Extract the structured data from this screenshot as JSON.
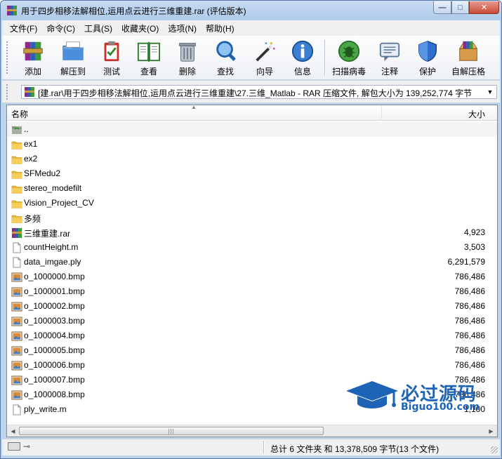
{
  "window": {
    "title": "用于四步相移法解相位,运用点云进行三维重建.rar (评估版本)",
    "controls": {
      "minimize": "—",
      "maximize": "□",
      "close": "✕"
    }
  },
  "menu": [
    "文件(F)",
    "命令(C)",
    "工具(S)",
    "收藏夹(O)",
    "选项(N)",
    "帮助(H)"
  ],
  "toolbar": {
    "buttons": [
      {
        "label": "添加",
        "icon": "add-archive-icon"
      },
      {
        "label": "解压到",
        "icon": "extract-folder-icon"
      },
      {
        "label": "测试",
        "icon": "test-clipboard-icon"
      },
      {
        "label": "查看",
        "icon": "view-book-icon"
      },
      {
        "label": "删除",
        "icon": "trash-icon"
      },
      {
        "label": "查找",
        "icon": "magnifier-icon"
      },
      {
        "label": "向导",
        "icon": "wizard-wand-icon"
      },
      {
        "label": "信息",
        "icon": "info-icon"
      },
      {
        "label": "扫描病毒",
        "icon": "virus-scan-icon"
      },
      {
        "label": "注释",
        "icon": "comment-icon"
      },
      {
        "label": "保护",
        "icon": "shield-icon"
      },
      {
        "label": "自解压格",
        "icon": "sfx-box-icon"
      }
    ]
  },
  "address": {
    "path": "[建.rar\\用于四步相移法解相位,运用点云进行三维重建\\27.三维_Matlab - RAR 压缩文件, 解包大小为 139,252,774 字节"
  },
  "list": {
    "columns": {
      "name": "名称",
      "size": "大小"
    },
    "rows": [
      {
        "name": "..",
        "size": "",
        "type": "parent"
      },
      {
        "name": "ex1",
        "size": "",
        "type": "folder"
      },
      {
        "name": "ex2",
        "size": "",
        "type": "folder"
      },
      {
        "name": "SFMedu2",
        "size": "",
        "type": "folder"
      },
      {
        "name": "stereo_modefilt",
        "size": "",
        "type": "folder"
      },
      {
        "name": "Vision_Project_CV",
        "size": "",
        "type": "folder"
      },
      {
        "name": "多频",
        "size": "",
        "type": "folder"
      },
      {
        "name": "三维重建.rar",
        "size": "4,923",
        "type": "rar"
      },
      {
        "name": "countHeight.m",
        "size": "3,503",
        "type": "file"
      },
      {
        "name": "data_imgae.ply",
        "size": "6,291,579",
        "type": "file"
      },
      {
        "name": "o_1000000.bmp",
        "size": "786,486",
        "type": "bmp"
      },
      {
        "name": "o_1000001.bmp",
        "size": "786,486",
        "type": "bmp"
      },
      {
        "name": "o_1000002.bmp",
        "size": "786,486",
        "type": "bmp"
      },
      {
        "name": "o_1000003.bmp",
        "size": "786,486",
        "type": "bmp"
      },
      {
        "name": "o_1000004.bmp",
        "size": "786,486",
        "type": "bmp"
      },
      {
        "name": "o_1000005.bmp",
        "size": "786,486",
        "type": "bmp"
      },
      {
        "name": "o_1000006.bmp",
        "size": "786,486",
        "type": "bmp"
      },
      {
        "name": "o_1000007.bmp",
        "size": "786,486",
        "type": "bmp"
      },
      {
        "name": "o_1000008.bmp",
        "size": "786,486",
        "type": "bmp"
      },
      {
        "name": "ply_write.m",
        "size": "1,100",
        "type": "file"
      }
    ]
  },
  "status": {
    "summary": "总计 6 文件夹 和 13,378,509 字节(13 个文件)"
  },
  "watermark": {
    "title": "必过源码",
    "subtitle": "Biguo100.com"
  },
  "colors": {
    "folder": "#e8b931",
    "accent": "#1d63b6",
    "close_button": "#c94a36"
  }
}
